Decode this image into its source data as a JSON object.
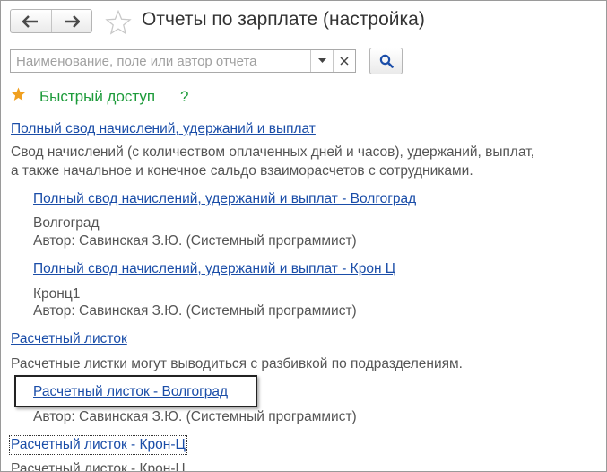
{
  "header": {
    "title": "Отчеты по зарплате (настройка)",
    "back_icon": "arrow-left-icon",
    "forward_icon": "arrow-right-icon",
    "favorite_icon": "star-outline-icon"
  },
  "search": {
    "placeholder": "Наименование, поле или автор отчета",
    "value": "",
    "dropdown_icon": "chevron-down-icon",
    "clear_icon": "close-icon",
    "search_icon": "magnifier-icon"
  },
  "quick_access": {
    "title": "Быстрый доступ",
    "help": "?",
    "icon": "star-filled-icon"
  },
  "reports": {
    "full_summary": {
      "link": "Полный свод начислений, удержаний и выплат",
      "desc_line1": "Свод начислений (с количеством оплаченных дней и часов), удержаний, выплат,",
      "desc_line2": "а также начальное и конечное сальдо взаиморасчетов с сотрудниками.",
      "variants": [
        {
          "link": "Полный свод начислений, удержаний и выплат - Волгоград",
          "desc": "Волгоград",
          "author": "Автор: Савинская З.Ю. (Системный программист)"
        },
        {
          "link": "Полный свод начислений, удержаний и выплат - Крон Ц",
          "desc": "Кронц1",
          "author": "Автор: Савинская З.Ю. (Системный программист)"
        }
      ]
    },
    "payslip": {
      "link": "Расчетный листок",
      "desc": "Расчетные листки могут выводиться с разбивкой по подразделениям.",
      "variants": [
        {
          "link": "Расчетный листок - Волгоград",
          "author": "Автор: Савинская З.Ю. (Системный программист)"
        }
      ]
    },
    "payslip_kron_link": "Расчетный листок - Крон-Ц",
    "payslip_kron_partial": "Расчетный листок - Крон-Ц"
  },
  "colors": {
    "link": "#1a4da8",
    "accent_green": "#1d9b3a",
    "star_orange": "#f0a020"
  }
}
